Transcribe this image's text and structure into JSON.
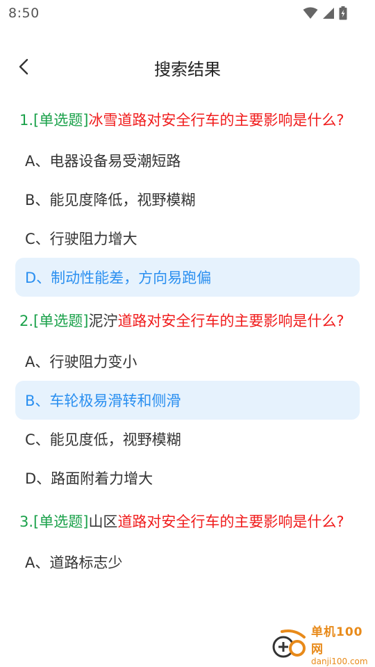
{
  "status": {
    "time": "8:50"
  },
  "header": {
    "title": "搜索结果"
  },
  "questions": [
    {
      "num": "1.",
      "type": "[单选题]",
      "prefix": "",
      "text": "冰雪道路对安全行车的主要影响是什么?",
      "options": [
        "A、电器设备易受潮短路",
        "B、能见度降低，视野模糊",
        "C、行驶阻力增大",
        "D、制动性能差，方向易跑偏"
      ],
      "correct_index": 3
    },
    {
      "num": "2.",
      "type": "[单选题]",
      "prefix": "泥泞",
      "text": "道路对安全行车的主要影响是什么?",
      "options": [
        "A、行驶阻力变小",
        "B、车轮极易滑转和侧滑",
        "C、能见度低，视野模糊",
        "D、路面附着力增大"
      ],
      "correct_index": 1
    },
    {
      "num": "3.",
      "type": "[单选题]",
      "prefix": "山区",
      "text": "道路对安全行车的主要影响是什么?",
      "options": [
        "A、道路标志少"
      ],
      "correct_index": -1
    }
  ],
  "watermark": {
    "cn": "单机100网",
    "url": "danji100.com"
  },
  "colors": {
    "green": "#1aa14a",
    "red": "#f01c1c",
    "blue": "#2a8ff0",
    "highlight": "#e6f2fd"
  }
}
